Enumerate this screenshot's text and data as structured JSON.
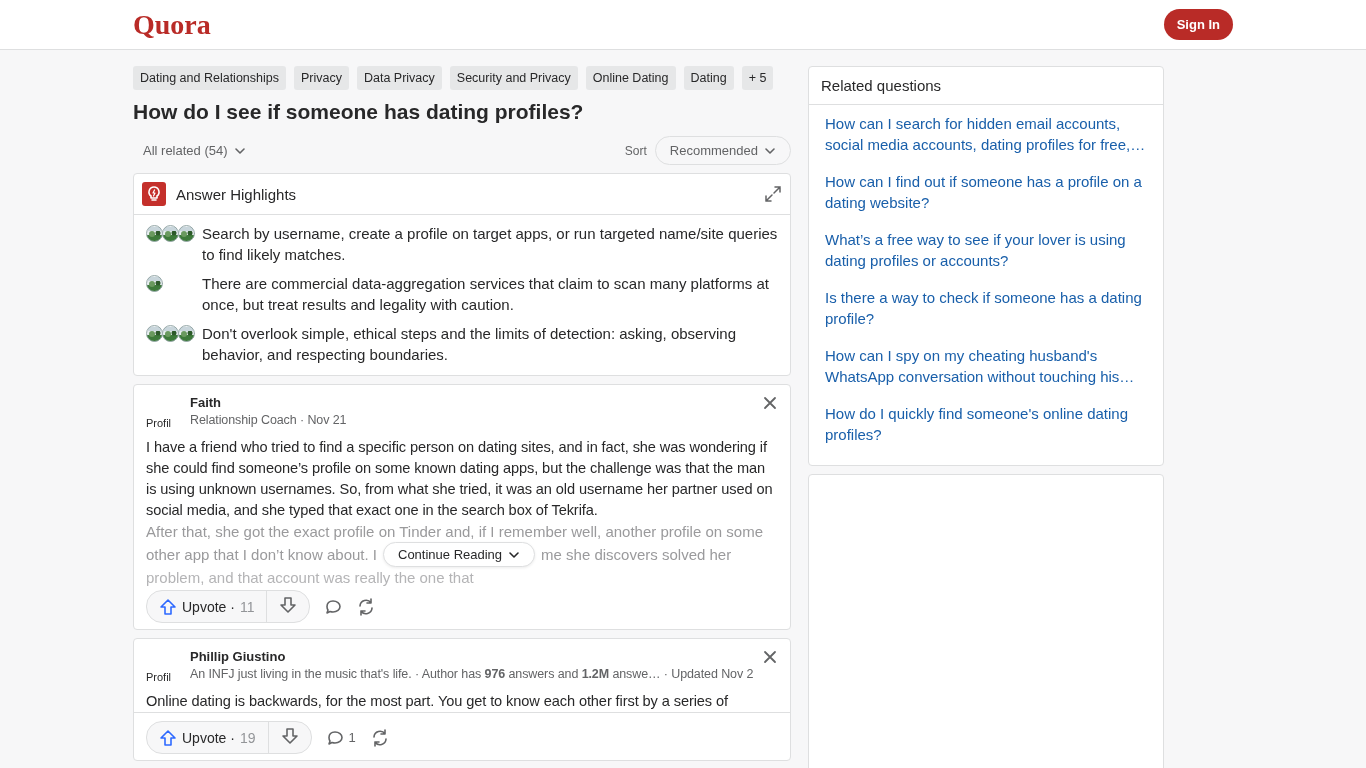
{
  "header": {
    "logo": "Quora",
    "sign_in": "Sign In"
  },
  "topics": [
    {
      "label": "Dating and Relationships"
    },
    {
      "label": "Privacy"
    },
    {
      "label": "Data Privacy"
    },
    {
      "label": "Security and Privacy"
    },
    {
      "label": "Online Dating"
    },
    {
      "label": "Dating"
    },
    {
      "label": "+ 5"
    }
  ],
  "question": "How do I see if someone has dating profiles?",
  "filter": {
    "label": "All related (54)",
    "sort_label": "Sort",
    "sort_value": "Recommended"
  },
  "highlights": {
    "title": "Answer Highlights",
    "items": [
      {
        "text": "Search by username, create a profile on target apps, or run targeted name/site queries to find likely matches."
      },
      {
        "text": "There are commercial data-aggregation services that claim to scan many platforms at once, but treat results and legality with caution."
      },
      {
        "text": "Don't overlook simple, ethical steps and the limits of detection: asking, observing behavior, and respecting boundaries."
      }
    ]
  },
  "answers": [
    {
      "avatar_alt": "Profil",
      "author": "Faith",
      "meta": "Relationship Coach · Nov 21",
      "body": "I have a friend who tried to find a specific person on dating sites, and in fact, she was wondering if she could find someone’s profile on some known dating apps, but the challenge was that the man is using unknown usernames. So, from what she tried, it was an old username her partner used on social media, and she typed that exact one in the search box of Tekrifa.",
      "faded": [
        "After that, she got the exact profile on Tinder and, if I remember well, another profile on some",
        "other app that I don’t know about. I",
        "me she discovers solved her",
        "problem, and that account was really the one that"
      ],
      "continue": "Continue Reading",
      "upvote": "Upvote ·",
      "upvotes": "11"
    },
    {
      "avatar_alt": "Profil",
      "author": "Phillip Giustino",
      "meta": "An INFJ just living in the music that's life. · Author has **976** answers and **1.2M** answe… · Updated Nov 2",
      "body": "Online dating is backwards, for the most part. You get to know each other first by a series of",
      "upvote": "Upvote ·",
      "upvotes": "19",
      "comments": "1"
    }
  ],
  "related": {
    "title": "Related questions",
    "items": [
      "How can I search for hidden email accounts, social media accounts, dating profiles for free,…",
      "How can I find out if someone has a profile on a dating website?",
      "What’s a free way to see if your lover is using dating profiles or accounts?",
      "Is there a way to check if someone has a dating profile?",
      "How can I spy on my cheating husband's WhatsApp conversation without touching his…",
      "How do I quickly find someone's online dating profiles?"
    ]
  }
}
